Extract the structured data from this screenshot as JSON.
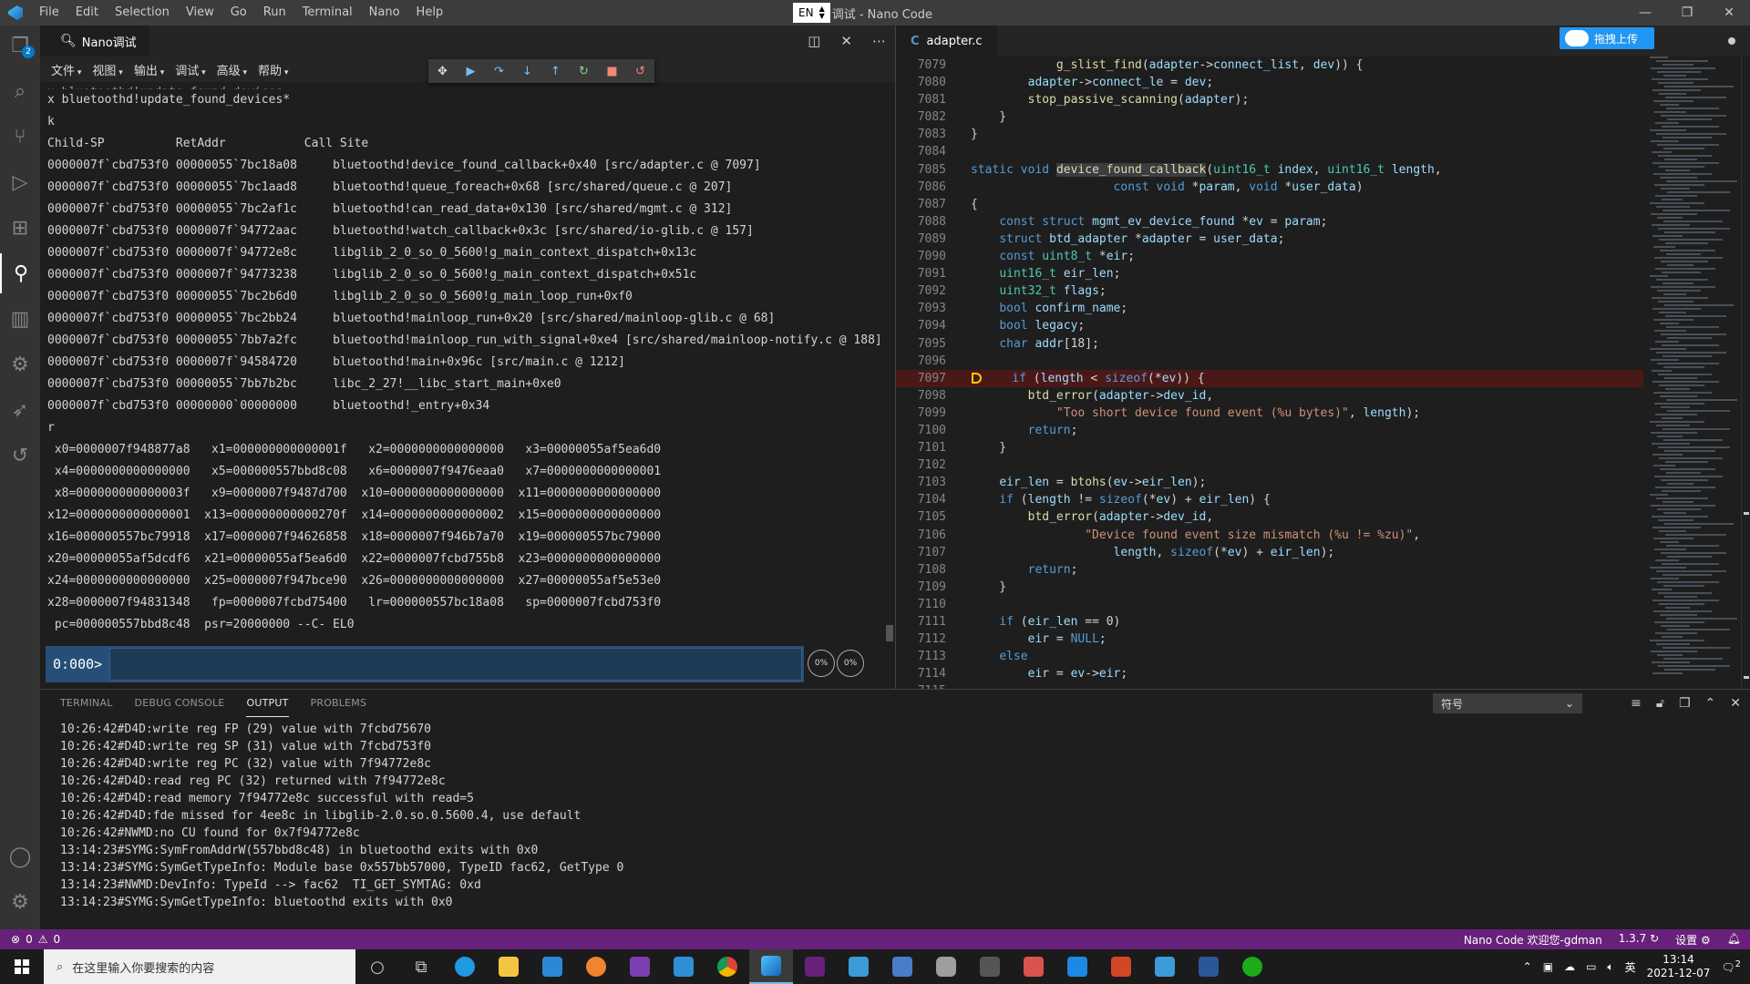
{
  "titlebar": {
    "menu": [
      "File",
      "Edit",
      "Selection",
      "View",
      "Go",
      "Run",
      "Terminal",
      "Nano",
      "Help"
    ],
    "ime": "EN",
    "window_title": "调试 - Nano Code"
  },
  "activity": {
    "explorer_badge": "2"
  },
  "nano_panel": {
    "tab_title": "Nano调试",
    "menus": [
      "文件",
      "视图",
      "输出",
      "调试",
      "高级",
      "帮助"
    ],
    "output_lines": [
      "x bluetoothd!update_found_devices*",
      "k",
      "Child-SP          RetAddr           Call Site",
      "0000007f`cbd753f0 00000055`7bc18a08     bluetoothd!device_found_callback+0x40 [src/adapter.c @ 7097]",
      "0000007f`cbd753f0 00000055`7bc1aad8     bluetoothd!queue_foreach+0x68 [src/shared/queue.c @ 207]",
      "0000007f`cbd753f0 00000055`7bc2af1c     bluetoothd!can_read_data+0x130 [src/shared/mgmt.c @ 312]",
      "0000007f`cbd753f0 0000007f`94772aac     bluetoothd!watch_callback+0x3c [src/shared/io-glib.c @ 157]",
      "0000007f`cbd753f0 0000007f`94772e8c     libglib_2_0_so_0_5600!g_main_context_dispatch+0x13c",
      "0000007f`cbd753f0 0000007f`94773238     libglib_2_0_so_0_5600!g_main_context_dispatch+0x51c",
      "0000007f`cbd753f0 00000055`7bc2b6d0     libglib_2_0_so_0_5600!g_main_loop_run+0xf0",
      "0000007f`cbd753f0 00000055`7bc2bb24     bluetoothd!mainloop_run+0x20 [src/shared/mainloop-glib.c @ 68]",
      "0000007f`cbd753f0 00000055`7bb7a2fc     bluetoothd!mainloop_run_with_signal+0xe4 [src/shared/mainloop-notify.c @ 188]",
      "0000007f`cbd753f0 0000007f`94584720     bluetoothd!main+0x96c [src/main.c @ 1212]",
      "0000007f`cbd753f0 00000055`7bb7b2bc     libc_2_27!__libc_start_main+0xe0",
      "0000007f`cbd753f0 00000000`00000000     bluetoothd!_entry+0x34",
      "r",
      " x0=0000007f948877a8   x1=000000000000001f   x2=0000000000000000   x3=00000055af5ea6d0",
      " x4=0000000000000000   x5=000000557bbd8c08   x6=0000007f9476eaa0   x7=0000000000000001",
      " x8=000000000000003f   x9=0000007f9487d700  x10=0000000000000000  x11=0000000000000000",
      "x12=0000000000000001  x13=000000000000270f  x14=0000000000000002  x15=0000000000000000",
      "x16=000000557bc79918  x17=0000007f94626858  x18=0000007f946b7a70  x19=000000557bc79000",
      "x20=00000055af5dcdf6  x21=00000055af5ea6d0  x22=0000007fcbd755b8  x23=0000000000000000",
      "x24=0000000000000000  x25=0000007f947bce90  x26=0000000000000000  x27=00000055af5e53e0",
      "x28=0000007f94831348   fp=0000007fcbd75400   lr=000000557bc18a08   sp=0000007fcbd753f0",
      " pc=000000557bbd8c48  psr=20000000 --C- EL0"
    ],
    "prompt": "0:000>",
    "btn1": "0%",
    "btn2": "0%"
  },
  "editor": {
    "tab_lang": "C",
    "tab_file": "adapter.c",
    "upload_label": "拖拽上传",
    "lines": [
      {
        "n": "7079",
        "t": "            g_slist_find(adapter->connect_list, dev)) {"
      },
      {
        "n": "7080",
        "t": "        adapter->connect_le = dev;"
      },
      {
        "n": "7081",
        "t": "        stop_passive_scanning(adapter);"
      },
      {
        "n": "7082",
        "t": "    }"
      },
      {
        "n": "7083",
        "t": "}"
      },
      {
        "n": "7084",
        "t": ""
      },
      {
        "n": "7085",
        "t": "static void device_found_callback(uint16_t index, uint16_t length,"
      },
      {
        "n": "7086",
        "t": "                    const void *param, void *user_data)"
      },
      {
        "n": "7087",
        "t": "{"
      },
      {
        "n": "7088",
        "t": "    const struct mgmt_ev_device_found *ev = param;"
      },
      {
        "n": "7089",
        "t": "    struct btd_adapter *adapter = user_data;"
      },
      {
        "n": "7090",
        "t": "    const uint8_t *eir;"
      },
      {
        "n": "7091",
        "t": "    uint16_t eir_len;"
      },
      {
        "n": "7092",
        "t": "    uint32_t flags;"
      },
      {
        "n": "7093",
        "t": "    bool confirm_name;"
      },
      {
        "n": "7094",
        "t": "    bool legacy;"
      },
      {
        "n": "7095",
        "t": "    char addr[18];"
      },
      {
        "n": "7096",
        "t": ""
      },
      {
        "n": "7097",
        "t": "    if (length < sizeof(*ev)) {"
      },
      {
        "n": "7098",
        "t": "        btd_error(adapter->dev_id,"
      },
      {
        "n": "7099",
        "t": "            \"Too short device found event (%u bytes)\", length);"
      },
      {
        "n": "7100",
        "t": "        return;"
      },
      {
        "n": "7101",
        "t": "    }"
      },
      {
        "n": "7102",
        "t": ""
      },
      {
        "n": "7103",
        "t": "    eir_len = btohs(ev->eir_len);"
      },
      {
        "n": "7104",
        "t": "    if (length != sizeof(*ev) + eir_len) {"
      },
      {
        "n": "7105",
        "t": "        btd_error(adapter->dev_id,"
      },
      {
        "n": "7106",
        "t": "                \"Device found event size mismatch (%u != %zu)\","
      },
      {
        "n": "7107",
        "t": "                    length, sizeof(*ev) + eir_len);"
      },
      {
        "n": "7108",
        "t": "        return;"
      },
      {
        "n": "7109",
        "t": "    }"
      },
      {
        "n": "7110",
        "t": ""
      },
      {
        "n": "7111",
        "t": "    if (eir_len == 0)"
      },
      {
        "n": "7112",
        "t": "        eir = NULL;"
      },
      {
        "n": "7113",
        "t": "    else"
      },
      {
        "n": "7114",
        "t": "        eir = ev->eir;"
      },
      {
        "n": "7115",
        "t": ""
      }
    ],
    "breakpoint_line": "7097"
  },
  "panel": {
    "tabs": [
      "TERMINAL",
      "DEBUG CONSOLE",
      "OUTPUT",
      "PROBLEMS"
    ],
    "active_tab": "OUTPUT",
    "select_value": "符号",
    "lines": [
      "10:26:42#D4D:write reg FP (29) value with 7fcbd75670",
      "10:26:42#D4D:write reg SP (31) value with 7fcbd753f0",
      "10:26:42#D4D:write reg PC (32) value with 7f94772e8c",
      "10:26:42#D4D:read reg PC (32) returned with 7f94772e8c",
      "10:26:42#D4D:read memory 7f94772e8c successful with read=5",
      "10:26:42#D4D:fde missed for 4ee8c in libglib-2.0.so.0.5600.4, use default",
      "10:26:42#NWMD:no CU found for 0x7f94772e8c",
      "13:14:23#SYMG:SymFromAddrW(557bbd8c48) in bluetoothd exits with 0x0",
      "13:14:23#SYMG:SymGetTypeInfo: Module base 0x557bb57000, TypeID fac62, GetType 0",
      "13:14:23#NWMD:DevInfo: TypeId --> fac62  TI_GET_SYMTAG: 0xd",
      "13:14:23#SYMG:SymGetTypeInfo: bluetoothd exits with 0x0"
    ]
  },
  "statusbar": {
    "errors": "0",
    "warnings": "0",
    "welcome": "Nano Code 欢迎您-gdman",
    "version": "1.3.7",
    "settings": "设置"
  },
  "taskbar": {
    "search_placeholder": "在这里输入你要搜索的内容",
    "time": "13:14",
    "date": "2021-12-07",
    "notification_count": "2"
  },
  "colors": {
    "statusbar": "#68217a",
    "breakpoint_line_bg": "#4b1818",
    "accent": "#007acc"
  }
}
